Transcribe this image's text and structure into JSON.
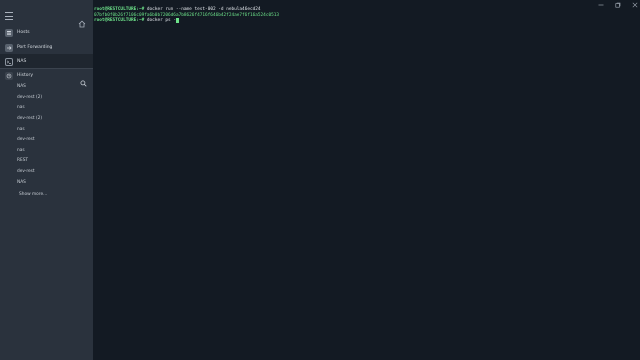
{
  "sidebar": {
    "nav": [
      {
        "label": "Hosts",
        "icon": "hosts-icon"
      },
      {
        "label": "Port Forwarding",
        "icon": "port-forwarding-icon"
      },
      {
        "label": "NAS",
        "icon": "terminal-icon"
      }
    ],
    "history_title": "History",
    "history": [
      "NAS",
      "dev-rest (2)",
      "nas",
      "dev-rest (2)",
      "nas",
      "dev-rest",
      "nas",
      "REST",
      "dev-rest",
      "NAS"
    ],
    "show_more": "Show more..."
  },
  "terminal": {
    "prompt": "root@RESTCULTURE:~#",
    "lines": [
      {
        "command": "docker run --name test-002 -d nebula46ecd24"
      },
      {
        "output": "07bfb0f0b26f7106c09fa6b0b7206d6a7b8626f4716f646b42f24ae7f6f16a524c0513"
      },
      {
        "command": "docker ps -"
      }
    ]
  },
  "colors": {
    "sidebar_bg": "#2a323d",
    "terminal_bg": "#131a23",
    "accent_green": "#6de38a"
  }
}
